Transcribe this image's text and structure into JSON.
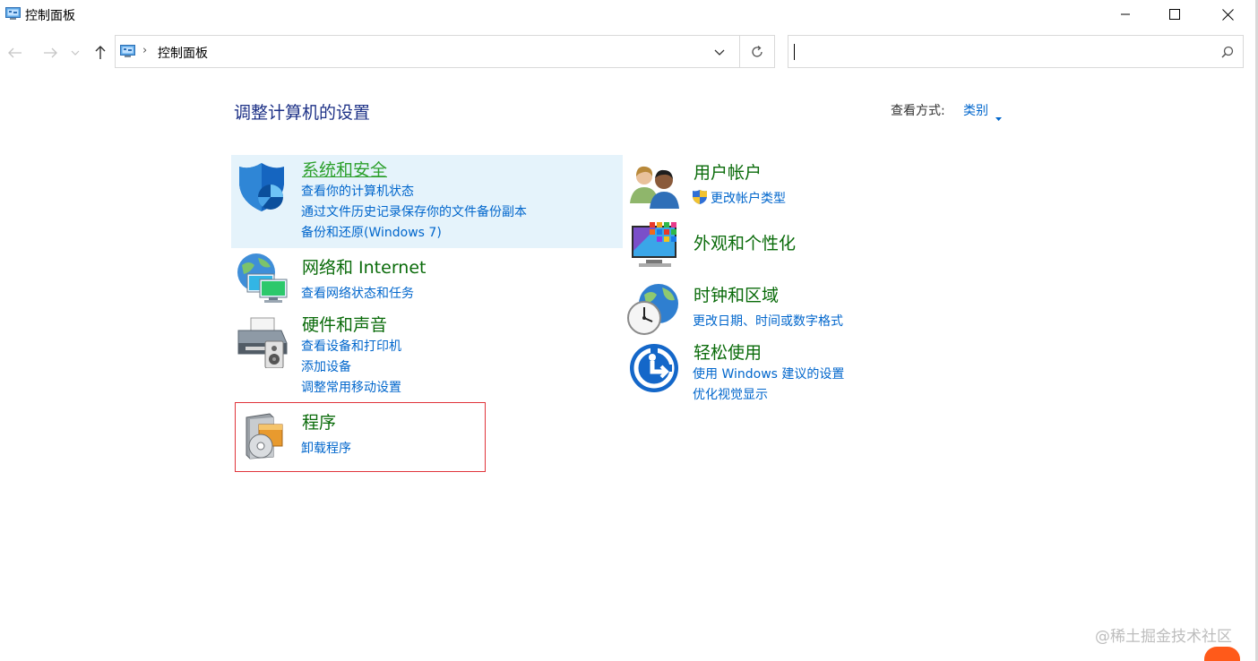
{
  "window": {
    "title": "控制面板"
  },
  "nav": {
    "breadcrumb": "控制面板",
    "search_value": ""
  },
  "header": {
    "title": "调整计算机的设置",
    "view_by_label": "查看方式:",
    "view_by_value": "类别"
  },
  "categories": {
    "system": {
      "title": "系统和安全",
      "links": [
        "查看你的计算机状态",
        "通过文件历史记录保存你的文件备份副本",
        "备份和还原(Windows 7)"
      ]
    },
    "network": {
      "title": "网络和 Internet",
      "links": [
        "查看网络状态和任务"
      ]
    },
    "hardware": {
      "title": "硬件和声音",
      "links": [
        "查看设备和打印机",
        "添加设备",
        "调整常用移动设置"
      ]
    },
    "programs": {
      "title": "程序",
      "links": [
        "卸载程序"
      ]
    },
    "users": {
      "title": "用户帐户",
      "links": [
        "更改帐户类型"
      ]
    },
    "appearance": {
      "title": "外观和个性化",
      "links": []
    },
    "clock": {
      "title": "时钟和区域",
      "links": [
        "更改日期、时间或数字格式"
      ]
    },
    "ease": {
      "title": "轻松使用",
      "links": [
        "使用 Windows 建议的设置",
        "优化视觉显示"
      ]
    }
  },
  "watermark": "@稀土掘金技术社区",
  "colors": {
    "link": "#0066cc",
    "category_title": "#0a6b0a",
    "hover_title": "#2ca02c",
    "selection_bg": "#e5f3fb",
    "highlight_box": "#e0343a",
    "page_title": "#1e3287"
  }
}
